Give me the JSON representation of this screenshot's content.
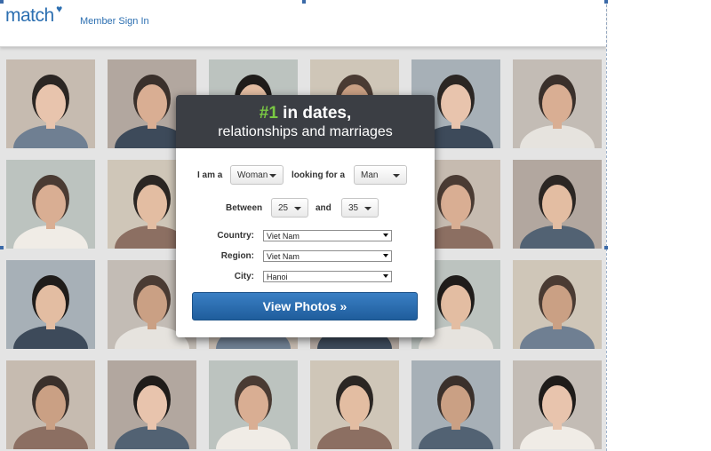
{
  "header": {
    "logo_text": "match",
    "sign_in_label": "Member Sign In"
  },
  "colors": {
    "brand_blue": "#2c6fb1",
    "headline_accent": "#7ac943",
    "dialog_header_bg": "#3b3e44",
    "cta_blue": "#2a6db0"
  },
  "photo_grid": {
    "rows": 4,
    "columns": 6,
    "description_icons": [
      "person-photo"
    ]
  },
  "search": {
    "headline_accent": "#1",
    "headline_rest": " in dates,",
    "headline_line2": "relationships and marriages",
    "i_am_a_label": "I am a",
    "i_am_a_value": "Woman",
    "looking_for_label": "looking for a",
    "looking_for_value": "Man",
    "between_label": "Between",
    "age_min": "25",
    "and_label": "and",
    "age_max": "35",
    "country_label": "Country:",
    "country_value": "Viet Nam",
    "region_label": "Region:",
    "region_value": "Viet Nam",
    "city_label": "City:",
    "city_value": "Hanoi",
    "submit_label": "View Photos »"
  }
}
